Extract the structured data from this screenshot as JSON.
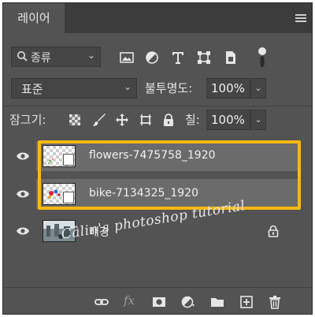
{
  "tab": {
    "label": "레이어"
  },
  "filter": {
    "label": "종류"
  },
  "blend": {
    "mode": "표준",
    "opacity_label": "불투명도:",
    "opacity_value": "100%"
  },
  "locks": {
    "label": "잠그기:",
    "fill_label": "칠:",
    "fill_value": "100%"
  },
  "layers": [
    {
      "name": "flowers-7475758_1920",
      "selected": true,
      "smart_object": true
    },
    {
      "name": "bike-7134325_1920",
      "selected": true,
      "smart_object": true
    },
    {
      "name": "배경",
      "selected": false,
      "locked": true
    }
  ],
  "watermark": "Câlin's photoshop tutorial",
  "colors": {
    "panel_bg": "#535353",
    "selected_row": "#6b6b6b",
    "highlight_border": "#f6b913"
  },
  "icons": {
    "filter_icons": [
      "image-filter-icon",
      "adjustment-filter-icon",
      "type-filter-icon",
      "shape-filter-icon",
      "smart-object-filter-icon",
      "filter-toggle-icon"
    ],
    "lock_icons": [
      "lock-transparent-pixels-icon",
      "lock-image-pixels-icon",
      "lock-position-icon",
      "lock-artboard-icon",
      "lock-all-icon"
    ],
    "bottom_icons": [
      "link-layers-icon",
      "fx-icon",
      "add-mask-icon",
      "new-adjustment-icon",
      "new-group-icon",
      "new-layer-icon",
      "delete-layer-icon"
    ]
  }
}
